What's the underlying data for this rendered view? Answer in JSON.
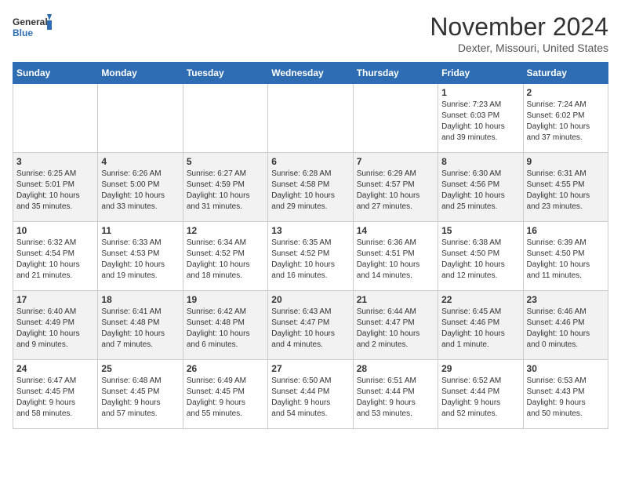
{
  "logo": {
    "line1": "General",
    "line2": "Blue"
  },
  "title": "November 2024",
  "location": "Dexter, Missouri, United States",
  "days_header": [
    "Sunday",
    "Monday",
    "Tuesday",
    "Wednesday",
    "Thursday",
    "Friday",
    "Saturday"
  ],
  "weeks": [
    [
      {
        "day": "",
        "content": ""
      },
      {
        "day": "",
        "content": ""
      },
      {
        "day": "",
        "content": ""
      },
      {
        "day": "",
        "content": ""
      },
      {
        "day": "",
        "content": ""
      },
      {
        "day": "1",
        "content": "Sunrise: 7:23 AM\nSunset: 6:03 PM\nDaylight: 10 hours\nand 39 minutes."
      },
      {
        "day": "2",
        "content": "Sunrise: 7:24 AM\nSunset: 6:02 PM\nDaylight: 10 hours\nand 37 minutes."
      }
    ],
    [
      {
        "day": "3",
        "content": "Sunrise: 6:25 AM\nSunset: 5:01 PM\nDaylight: 10 hours\nand 35 minutes."
      },
      {
        "day": "4",
        "content": "Sunrise: 6:26 AM\nSunset: 5:00 PM\nDaylight: 10 hours\nand 33 minutes."
      },
      {
        "day": "5",
        "content": "Sunrise: 6:27 AM\nSunset: 4:59 PM\nDaylight: 10 hours\nand 31 minutes."
      },
      {
        "day": "6",
        "content": "Sunrise: 6:28 AM\nSunset: 4:58 PM\nDaylight: 10 hours\nand 29 minutes."
      },
      {
        "day": "7",
        "content": "Sunrise: 6:29 AM\nSunset: 4:57 PM\nDaylight: 10 hours\nand 27 minutes."
      },
      {
        "day": "8",
        "content": "Sunrise: 6:30 AM\nSunset: 4:56 PM\nDaylight: 10 hours\nand 25 minutes."
      },
      {
        "day": "9",
        "content": "Sunrise: 6:31 AM\nSunset: 4:55 PM\nDaylight: 10 hours\nand 23 minutes."
      }
    ],
    [
      {
        "day": "10",
        "content": "Sunrise: 6:32 AM\nSunset: 4:54 PM\nDaylight: 10 hours\nand 21 minutes."
      },
      {
        "day": "11",
        "content": "Sunrise: 6:33 AM\nSunset: 4:53 PM\nDaylight: 10 hours\nand 19 minutes."
      },
      {
        "day": "12",
        "content": "Sunrise: 6:34 AM\nSunset: 4:52 PM\nDaylight: 10 hours\nand 18 minutes."
      },
      {
        "day": "13",
        "content": "Sunrise: 6:35 AM\nSunset: 4:52 PM\nDaylight: 10 hours\nand 16 minutes."
      },
      {
        "day": "14",
        "content": "Sunrise: 6:36 AM\nSunset: 4:51 PM\nDaylight: 10 hours\nand 14 minutes."
      },
      {
        "day": "15",
        "content": "Sunrise: 6:38 AM\nSunset: 4:50 PM\nDaylight: 10 hours\nand 12 minutes."
      },
      {
        "day": "16",
        "content": "Sunrise: 6:39 AM\nSunset: 4:50 PM\nDaylight: 10 hours\nand 11 minutes."
      }
    ],
    [
      {
        "day": "17",
        "content": "Sunrise: 6:40 AM\nSunset: 4:49 PM\nDaylight: 10 hours\nand 9 minutes."
      },
      {
        "day": "18",
        "content": "Sunrise: 6:41 AM\nSunset: 4:48 PM\nDaylight: 10 hours\nand 7 minutes."
      },
      {
        "day": "19",
        "content": "Sunrise: 6:42 AM\nSunset: 4:48 PM\nDaylight: 10 hours\nand 6 minutes."
      },
      {
        "day": "20",
        "content": "Sunrise: 6:43 AM\nSunset: 4:47 PM\nDaylight: 10 hours\nand 4 minutes."
      },
      {
        "day": "21",
        "content": "Sunrise: 6:44 AM\nSunset: 4:47 PM\nDaylight: 10 hours\nand 2 minutes."
      },
      {
        "day": "22",
        "content": "Sunrise: 6:45 AM\nSunset: 4:46 PM\nDaylight: 10 hours\nand 1 minute."
      },
      {
        "day": "23",
        "content": "Sunrise: 6:46 AM\nSunset: 4:46 PM\nDaylight: 10 hours\nand 0 minutes."
      }
    ],
    [
      {
        "day": "24",
        "content": "Sunrise: 6:47 AM\nSunset: 4:45 PM\nDaylight: 9 hours\nand 58 minutes."
      },
      {
        "day": "25",
        "content": "Sunrise: 6:48 AM\nSunset: 4:45 PM\nDaylight: 9 hours\nand 57 minutes."
      },
      {
        "day": "26",
        "content": "Sunrise: 6:49 AM\nSunset: 4:45 PM\nDaylight: 9 hours\nand 55 minutes."
      },
      {
        "day": "27",
        "content": "Sunrise: 6:50 AM\nSunset: 4:44 PM\nDaylight: 9 hours\nand 54 minutes."
      },
      {
        "day": "28",
        "content": "Sunrise: 6:51 AM\nSunset: 4:44 PM\nDaylight: 9 hours\nand 53 minutes."
      },
      {
        "day": "29",
        "content": "Sunrise: 6:52 AM\nSunset: 4:44 PM\nDaylight: 9 hours\nand 52 minutes."
      },
      {
        "day": "30",
        "content": "Sunrise: 6:53 AM\nSunset: 4:43 PM\nDaylight: 9 hours\nand 50 minutes."
      }
    ]
  ]
}
